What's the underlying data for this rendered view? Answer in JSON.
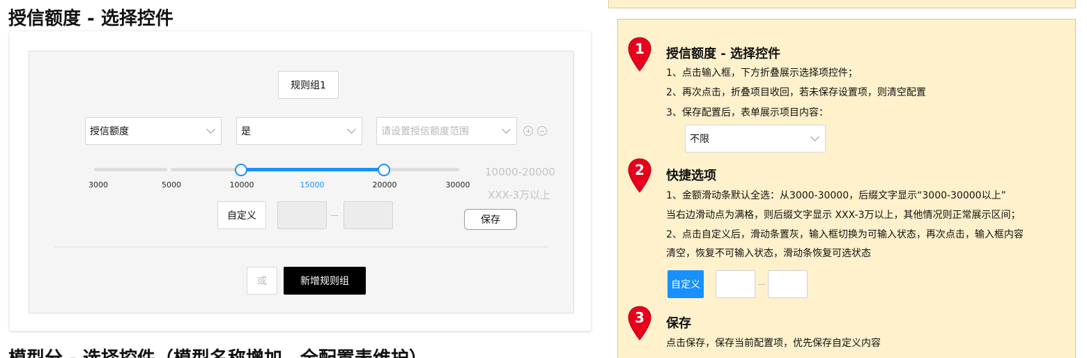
{
  "page": {
    "title": "授信额度 - 选择控件",
    "next_title": "模型分 - 选择控件（模型名称增加，全配置表维护）"
  },
  "editor": {
    "rule_group_label": "规则组1",
    "field_select": "授信额度",
    "operator_select": "是",
    "range_placeholder": "请设置授信额度范围",
    "slider": {
      "ticks": [
        "3000",
        "5000",
        "10000",
        "15000",
        "20000",
        "30000"
      ],
      "active_tick": "15000",
      "selected_min": "10000",
      "selected_max": "20000",
      "suffix_line1": "10000-20000",
      "suffix_line2": "XXX-3万以上"
    },
    "custom_label": "自定义",
    "save_label": "保存",
    "or_label": "或",
    "add_group_label": "新增规则组"
  },
  "notes": {
    "accent_color": "#e8001c",
    "items": [
      {
        "number": "1",
        "heading": "授信额度 - 选择控件",
        "lines": [
          "1、点击输入框，下方折叠展示选择项控件；",
          "2、再次点击，折叠项目收回，若未保存设置项，则清空配置",
          "3、保存配置后，表单展示项目内容："
        ],
        "example_select": "不限"
      },
      {
        "number": "2",
        "heading": "快捷选项",
        "lines": [
          "1、金额滑动条默认全选：从3000-30000，后缀文字显示“3000-30000以上”",
          "当右边滑动点为满格，则后缀文字显示 XXX-3万以上，其他情况则正常展示区间；",
          "2、点击自定义后，滑动条置灰，输入框切换为可输入状态，再次点击，输入框内容",
          "清空，恢复不可输入状态，滑动条恢复可选状态"
        ],
        "example_button": "自定义"
      },
      {
        "number": "3",
        "heading": "保存",
        "lines": [
          "点击保存，保存当前配置项，优先保存自定义内容"
        ]
      }
    ]
  }
}
